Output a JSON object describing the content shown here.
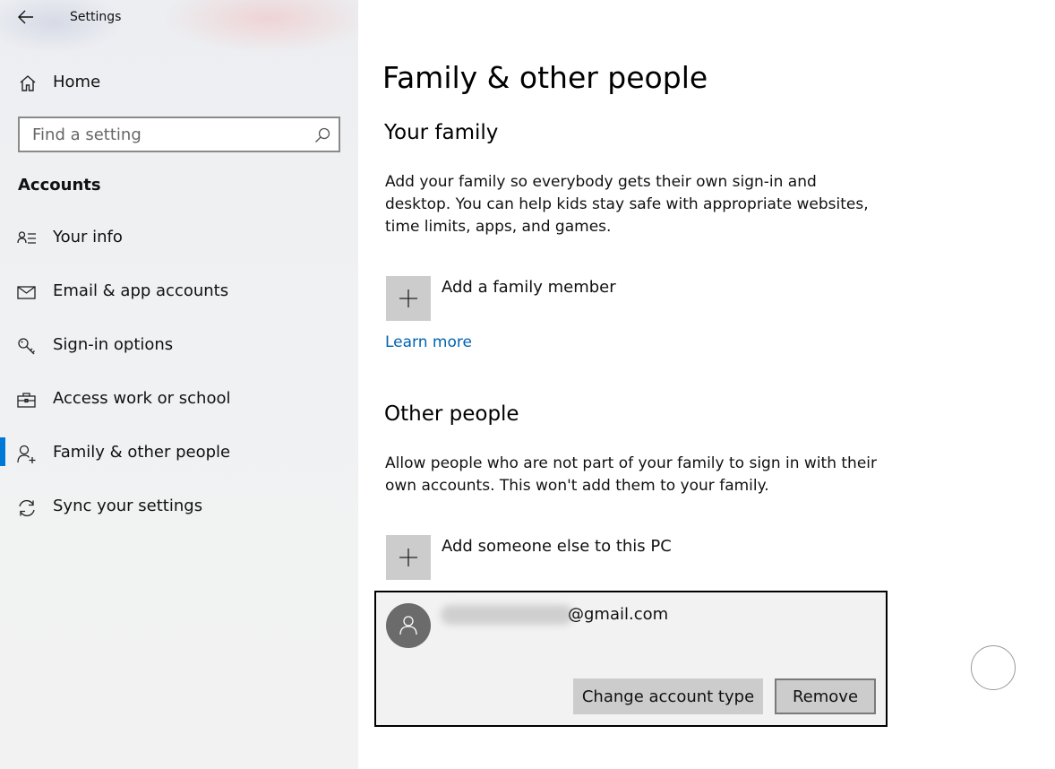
{
  "window": {
    "title": "Settings"
  },
  "sidebar": {
    "home_label": "Home",
    "search": {
      "placeholder": "Find a setting",
      "value": ""
    },
    "section_label": "Accounts",
    "items": [
      {
        "label": "Your info",
        "icon": "contact-card-icon"
      },
      {
        "label": "Email & app accounts",
        "icon": "mail-icon"
      },
      {
        "label": "Sign-in options",
        "icon": "key-icon"
      },
      {
        "label": "Access work or school",
        "icon": "briefcase-icon"
      },
      {
        "label": "Family & other people",
        "icon": "add-person-icon",
        "active": true
      },
      {
        "label": "Sync your settings",
        "icon": "sync-icon"
      }
    ],
    "accent_color": "#0078d7"
  },
  "main": {
    "page_title": "Family & other people",
    "your_family": {
      "heading": "Your family",
      "description": "Add your family so everybody gets their own sign-in and desktop. You can help kids stay safe with appropriate websites, time limits, apps, and games.",
      "add_label": "Add a family member",
      "learn_more": "Learn more"
    },
    "other_people": {
      "heading": "Other people",
      "description": "Allow people who are not part of your family to sign in with their own accounts. This won't add them to your family.",
      "add_label": "Add someone else to this PC",
      "account": {
        "email_suffix": "@gmail.com",
        "change_type_label": "Change account type",
        "remove_label": "Remove"
      }
    },
    "link_color": "#0063b1"
  }
}
